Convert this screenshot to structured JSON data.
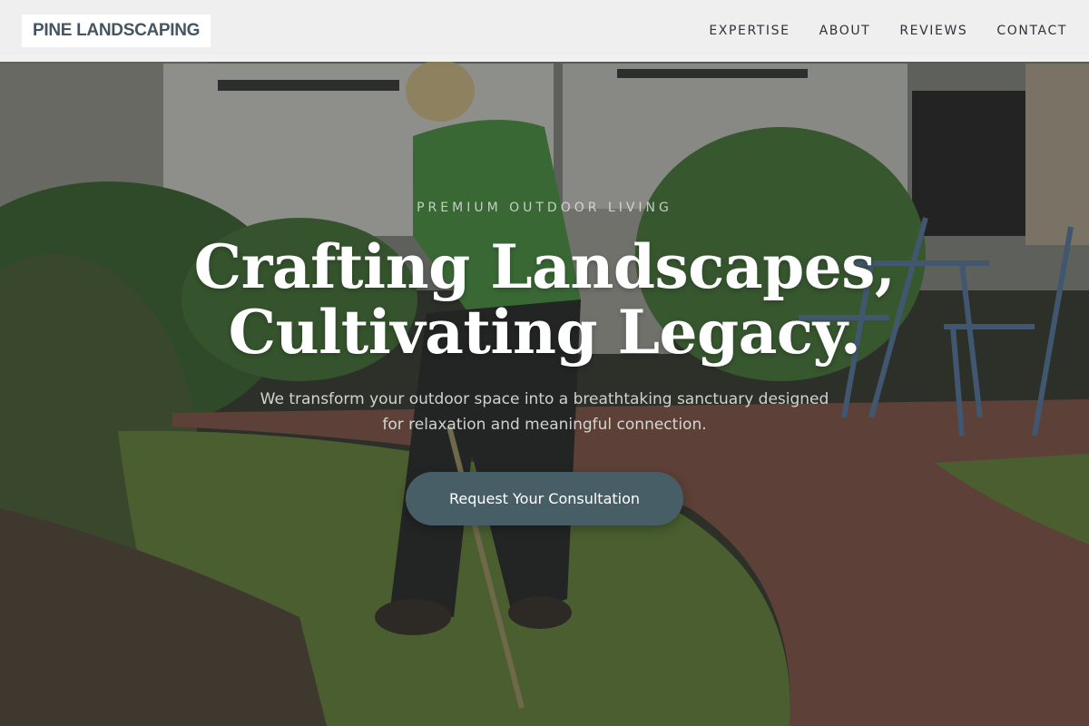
{
  "brand": {
    "name": "PINE LANDSCAPING"
  },
  "nav": {
    "items": [
      {
        "label": "EXPERTISE"
      },
      {
        "label": "ABOUT"
      },
      {
        "label": "REVIEWS"
      },
      {
        "label": "CONTACT"
      }
    ]
  },
  "hero": {
    "eyebrow": "PREMIUM OUTDOOR LIVING",
    "headline_line1": "Crafting Landscapes,",
    "headline_line2": "Cultivating Legacy.",
    "subtext": "We transform your outdoor space into a breathtaking sanctuary designed for relaxation and meaningful connection.",
    "cta_label": "Request Your Consultation",
    "background_image": "landscaper-trimming-lawn-photo"
  },
  "colors": {
    "header_bg": "#f6f6f7",
    "logo_text": "#455561",
    "cta_bg": "#485e66",
    "headline": "#ffffff"
  }
}
